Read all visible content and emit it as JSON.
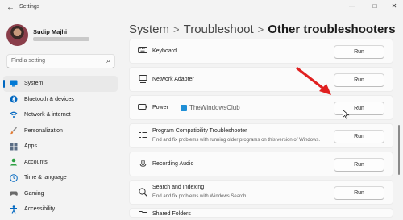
{
  "window": {
    "title": "Settings",
    "controls": {
      "minimize": "—",
      "maximize": "□",
      "close": "✕"
    }
  },
  "profile": {
    "name": "Sudip Majhi"
  },
  "search": {
    "placeholder": "Find a setting"
  },
  "sidebar": {
    "items": [
      {
        "label": "System",
        "icon": "system-icon",
        "color": "#0078d4"
      },
      {
        "label": "Bluetooth & devices",
        "icon": "bluetooth-icon",
        "color": "#0067c0"
      },
      {
        "label": "Network & internet",
        "icon": "wifi-icon",
        "color": "#0067c0"
      },
      {
        "label": "Personalization",
        "icon": "brush-icon",
        "color": "#e17b35"
      },
      {
        "label": "Apps",
        "icon": "apps-icon",
        "color": "#5a6c84"
      },
      {
        "label": "Accounts",
        "icon": "accounts-icon",
        "color": "#2ea043"
      },
      {
        "label": "Time & language",
        "icon": "globe-clock-icon",
        "color": "#0067c0"
      },
      {
        "label": "Gaming",
        "icon": "gamepad-icon",
        "color": "#6b6b6b"
      },
      {
        "label": "Accessibility",
        "icon": "accessibility-icon",
        "color": "#0067c0"
      }
    ]
  },
  "breadcrumb": {
    "items": [
      "System",
      "Troubleshoot"
    ],
    "current": "Other troubleshooters",
    "separator": ">"
  },
  "troubleshooters": [
    {
      "label": "Keyboard",
      "description": "",
      "icon": "keyboard-icon",
      "button": "Run"
    },
    {
      "label": "Network Adapter",
      "description": "",
      "icon": "network-adapter-icon",
      "button": "Run"
    },
    {
      "label": "Power",
      "description": "",
      "icon": "battery-icon",
      "button": "Run"
    },
    {
      "label": "Program Compatibility Troubleshooter",
      "description": "Find and fix problems with running older programs on this version of Windows.",
      "icon": "program-compatibility-icon",
      "button": "Run"
    },
    {
      "label": "Recording Audio",
      "description": "",
      "icon": "microphone-icon",
      "button": "Run"
    },
    {
      "label": "Search and Indexing",
      "description": "Find and fix problems with Windows Search",
      "icon": "search-icon",
      "button": "Run"
    },
    {
      "label": "Shared Folders",
      "description": "",
      "icon": "shared-folder-icon",
      "button": ""
    }
  ],
  "watermark": {
    "text": "TheWindowsClub"
  },
  "annotation": {
    "arrow_color": "#e02020"
  }
}
